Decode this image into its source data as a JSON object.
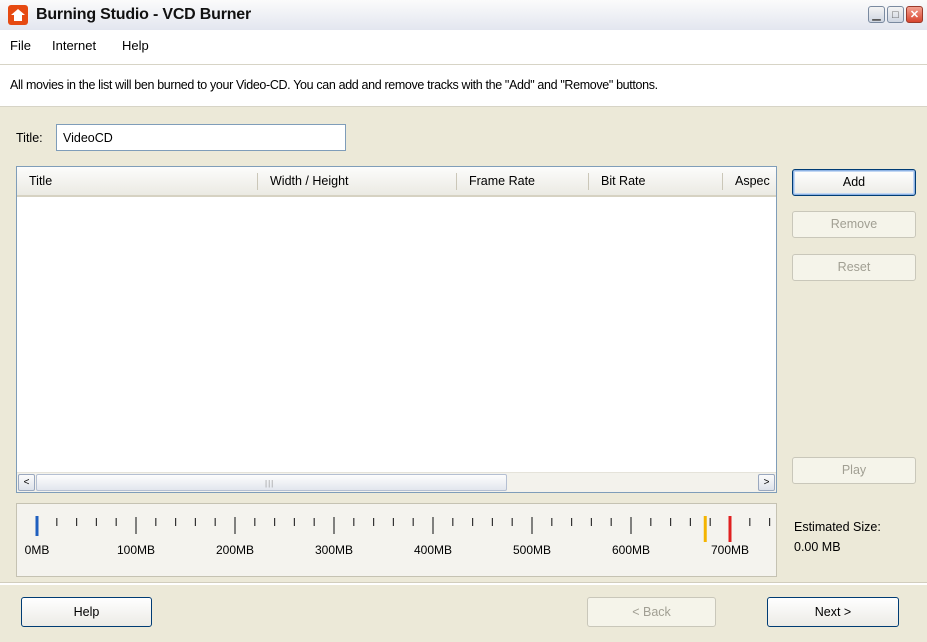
{
  "window": {
    "title": "Burning Studio - VCD Burner"
  },
  "menu": {
    "items": [
      {
        "label": "File"
      },
      {
        "label": "Internet"
      },
      {
        "label": "Help"
      }
    ]
  },
  "info_text": "All movies in the list will ben burned to your Video-CD. You can add and remove tracks with the \"Add\" and \"Remove\" buttons.",
  "title_field": {
    "label": "Title:",
    "value": "VideoCD"
  },
  "list": {
    "columns": [
      {
        "label": "Title"
      },
      {
        "label": "Width / Height"
      },
      {
        "label": "Frame Rate"
      },
      {
        "label": "Bit Rate"
      },
      {
        "label": "Aspec"
      }
    ]
  },
  "scrollbar": {
    "left_arrow": "<",
    "right_arrow": ">",
    "grip": "|||"
  },
  "side_buttons": {
    "add": "Add",
    "remove": "Remove",
    "reset": "Reset",
    "play": "Play"
  },
  "size_ruler": {
    "unit": "MB",
    "max_mb": 760,
    "tick_step_mb": 20,
    "labels": [
      "0MB",
      "100MB",
      "200MB",
      "300MB",
      "400MB",
      "500MB",
      "600MB",
      "700MB"
    ],
    "label_values": [
      0,
      100,
      200,
      300,
      400,
      500,
      600,
      700
    ],
    "current_mb": 0,
    "markers": [
      {
        "value_mb": 675,
        "color": "#f4b400"
      },
      {
        "value_mb": 700,
        "color": "#e02020"
      }
    ]
  },
  "estimate": {
    "label": "Estimated Size:",
    "value": "0.00 MB"
  },
  "footer": {
    "help": "Help",
    "back": "< Back",
    "next": "Next >"
  }
}
